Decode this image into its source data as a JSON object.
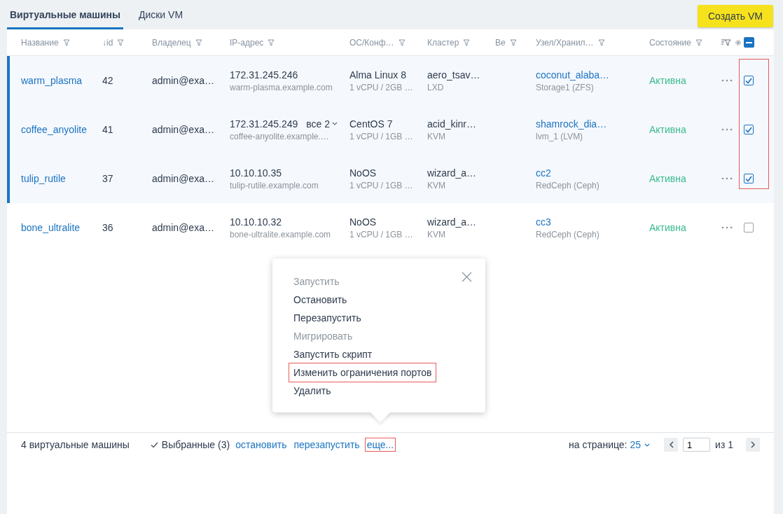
{
  "tabs": [
    {
      "label": "Виртуальные машины",
      "selected": true
    },
    {
      "label": "Диски VM",
      "selected": false
    }
  ],
  "create_button": "Создать VM",
  "table": {
    "columns": [
      "Название",
      "↓id",
      "Владелец",
      "IP-адрес",
      "ОС/Конф…",
      "Кластер",
      "Ве",
      "Узел/Хранил…",
      "Состояние"
    ],
    "select_all_partial": true,
    "checkbox_highlight": true,
    "rows": [
      {
        "name": "warm_plasma",
        "id": "42",
        "owner": "admin@exa…",
        "ip": "172.31.245.246",
        "host": "warm-plasma.example.com",
        "os": "Alma Linux 8",
        "config": "1 vCPU / 2GB …",
        "cluster": "aero_tsav…",
        "virt": "LXD",
        "node": "coconut_alaba…",
        "storage": "Storage1 (ZFS)",
        "state": "Активна",
        "selected": true
      },
      {
        "name": "coffee_anyolite",
        "id": "41",
        "owner": "admin@exa…",
        "ip": "172.31.245.249",
        "ip_more": "все 2",
        "host": "coffee-anyolite.example.…",
        "os": "CentOS 7",
        "config": "1 vCPU / 1GB …",
        "cluster": "acid_kinr…",
        "virt": "KVM",
        "node": "shamrock_dia…",
        "storage": "lvm_1 (LVM)",
        "state": "Активна",
        "selected": true
      },
      {
        "name": "tulip_rutile",
        "id": "37",
        "owner": "admin@exa…",
        "ip": "10.10.10.35",
        "host": "tulip-rutile.example.com",
        "os": "NoOS",
        "config": "1 vCPU / 1GB …",
        "cluster": "wizard_a…",
        "virt": "KVM",
        "node": "cc2",
        "storage": "RedCeph (Ceph)",
        "state": "Активна",
        "selected": true
      },
      {
        "name": "bone_ultralite",
        "id": "36",
        "owner": "admin@exa…",
        "ip": "10.10.10.32",
        "host": "bone-ultralite.example.com",
        "os": "NoOS",
        "config": "1 vCPU / 1GB …",
        "cluster": "wizard_a…",
        "virt": "KVM",
        "node": "cc3",
        "storage": "RedCeph (Ceph)",
        "state": "Активна",
        "selected": false
      }
    ]
  },
  "popup_menu": {
    "items": [
      {
        "label": "Запустить",
        "disabled": true,
        "highlighted": false
      },
      {
        "label": "Остановить",
        "disabled": false,
        "highlighted": false
      },
      {
        "label": "Перезапустить",
        "disabled": false,
        "highlighted": false
      },
      {
        "label": "Мигрировать",
        "disabled": true,
        "highlighted": false
      },
      {
        "label": "Запустить скрипт",
        "disabled": false,
        "highlighted": false
      },
      {
        "label": "Изменить ограничения портов",
        "disabled": false,
        "highlighted": true
      },
      {
        "label": "Удалить",
        "disabled": false,
        "highlighted": false
      }
    ]
  },
  "footer": {
    "count": "4 виртуальные машины",
    "selected": "Выбранные (3)",
    "actions": [
      {
        "label": "остановить",
        "highlighted": false
      },
      {
        "label": "перезапустить",
        "highlighted": false
      },
      {
        "label": "еще...",
        "highlighted": true
      }
    ],
    "per_page_label": "на странице:",
    "per_page": "25",
    "page": "1",
    "page_total": "из 1"
  }
}
